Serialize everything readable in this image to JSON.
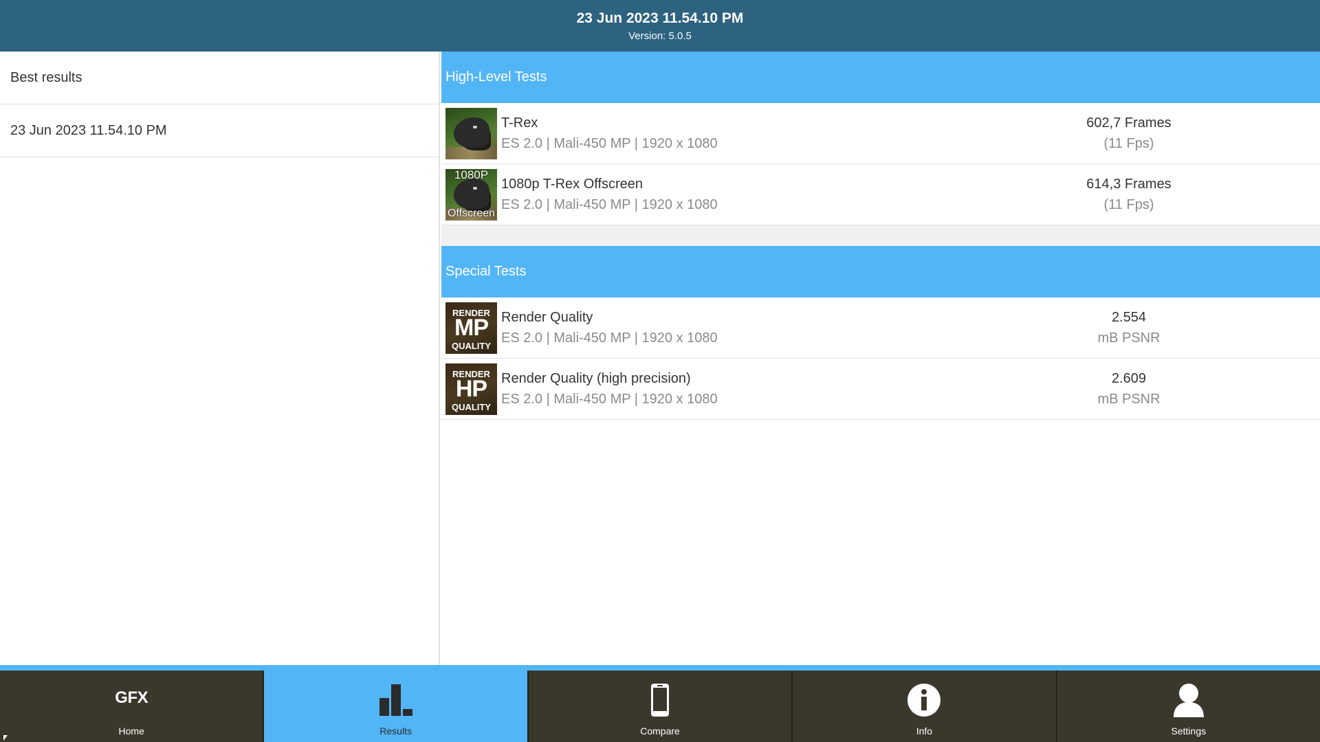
{
  "header": {
    "title": "23 Jun 2023 11.54.10 PM",
    "version": "Version: 5.0.5"
  },
  "left_list": [
    {
      "label": "Best results"
    },
    {
      "label": "23 Jun 2023 11.54.10 PM"
    }
  ],
  "sections": [
    {
      "title": "High-Level Tests",
      "tests": [
        {
          "name": "T-Rex",
          "detail": "ES 2.0 | Mali-450 MP | 1920 x 1080",
          "score": "602,7 Frames",
          "score_sub": "(11 Fps)",
          "thumb_top": "",
          "thumb_bottom": ""
        },
        {
          "name": "1080p T-Rex Offscreen",
          "detail": "ES 2.0 | Mali-450 MP | 1920 x 1080",
          "score": "614,3 Frames",
          "score_sub": "(11 Fps)",
          "thumb_top": "1080P",
          "thumb_bottom": "Offscreen"
        }
      ]
    },
    {
      "title": "Special Tests",
      "tests": [
        {
          "name": "Render Quality",
          "detail": "ES 2.0 | Mali-450 MP | 1920 x 1080",
          "score": "2.554",
          "score_sub": "mB PSNR",
          "thumb_top": "RENDER",
          "thumb_big": "MP",
          "thumb_bottom": "QUALITY"
        },
        {
          "name": "Render Quality (high precision)",
          "detail": "ES 2.0 | Mali-450 MP | 1920 x 1080",
          "score": "2.609",
          "score_sub": "mB PSNR",
          "thumb_top": "RENDER",
          "thumb_big": "HP",
          "thumb_bottom": "QUALITY"
        }
      ]
    }
  ],
  "nav": {
    "home": {
      "logo": "GFX",
      "label": "Home",
      "icon": "gfx-logo-icon"
    },
    "results": {
      "label": "Results",
      "icon": "bar-chart-icon"
    },
    "compare": {
      "label": "Compare",
      "icon": "phone-icon"
    },
    "info": {
      "label": "Info",
      "icon": "info-icon"
    },
    "settings": {
      "label": "Settings",
      "icon": "user-icon"
    }
  },
  "colors": {
    "header_bg": "#2d6280",
    "accent": "#52b5f5",
    "nav_bg": "#3a372b"
  }
}
